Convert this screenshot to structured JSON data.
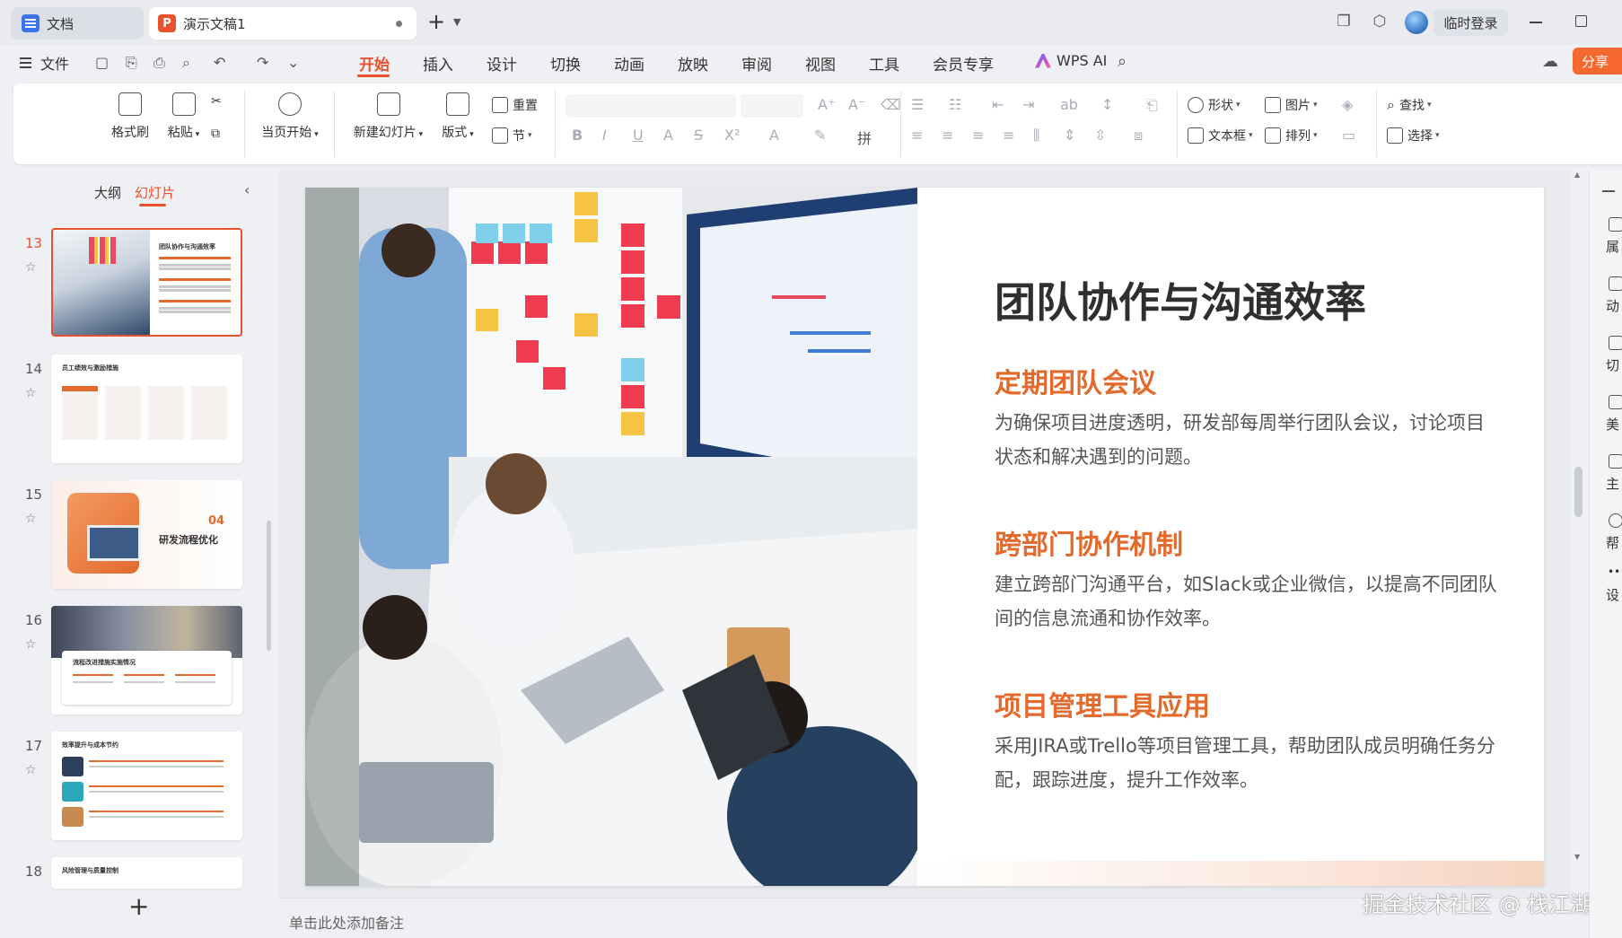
{
  "titlebar": {
    "tabs": [
      {
        "label": "文档"
      },
      {
        "label": "演示文稿1"
      }
    ],
    "login_label": "临时登录"
  },
  "menubar": {
    "file_label": "文件",
    "tabs": [
      "开始",
      "插入",
      "设计",
      "切换",
      "动画",
      "放映",
      "审阅",
      "视图",
      "工具",
      "会员专享"
    ],
    "active_tab": "开始",
    "wps_ai_label": "WPS AI",
    "share_label": "分享"
  },
  "ribbon": {
    "format_painter": "格式刷",
    "paste": "粘贴",
    "play_from_current": "当页开始",
    "new_slide": "新建幻灯片",
    "layout": "版式",
    "reset": "重置",
    "section": "节",
    "shape": "形状",
    "picture": "图片",
    "textbox": "文本框",
    "arrange": "排列",
    "find": "查找",
    "select": "选择"
  },
  "left_panel": {
    "tabs": [
      "大纲",
      "幻灯片"
    ],
    "active_tab": "幻灯片",
    "slides": [
      {
        "number": "13",
        "title": "团队协作与沟通效率"
      },
      {
        "number": "14",
        "title": "员工绩效与激励措施"
      },
      {
        "number": "15",
        "title": "研发流程优化",
        "badge": "04"
      },
      {
        "number": "16",
        "title": "流程改进措施实施情况"
      },
      {
        "number": "17",
        "title": "效率提升与成本节约"
      },
      {
        "number": "18",
        "title": "风险管理与质量控制"
      }
    ],
    "selected": "13"
  },
  "slide": {
    "title": "团队协作与沟通效率",
    "sections": [
      {
        "heading": "定期团队会议",
        "body": "为确保项目进度透明，研发部每周举行团队会议，讨论项目状态和解决遇到的问题。"
      },
      {
        "heading": "跨部门协作机制",
        "body": "建立跨部门沟通平台，如Slack或企业微信，以提高不同团队间的信息流通和协作效率。"
      },
      {
        "heading": "项目管理工具应用",
        "body": "采用JIRA或Trello等项目管理工具，帮助团队成员明确任务分配，跟踪进度，提升工作效率。"
      }
    ]
  },
  "notes_placeholder": "单击此处添加备注",
  "watermark": "掘金技术社区 @ 栈江湖",
  "right_sidebar": {
    "items": [
      "属",
      "动",
      "切",
      "美",
      "主",
      "帮",
      "设"
    ]
  },
  "colors": {
    "accent": "#e8512d",
    "heading": "#e36a2d"
  }
}
